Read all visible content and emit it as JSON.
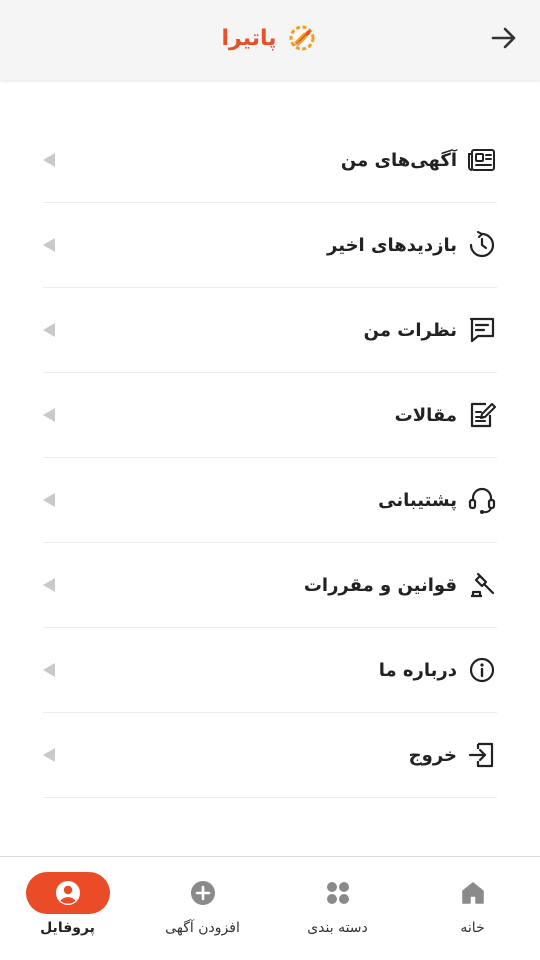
{
  "header": {
    "brand_name": "پاتیرا",
    "back_icon": "arrow-right-icon",
    "logo_icon": "gear-rocket-logo",
    "accent_color": "#e8502a"
  },
  "menu": {
    "items": [
      {
        "label": "آگهی‌های من",
        "icon": "ads-list-icon"
      },
      {
        "label": "بازدیدهای اخیر",
        "icon": "history-icon"
      },
      {
        "label": "نظرات من",
        "icon": "comment-icon"
      },
      {
        "label": "مقالات",
        "icon": "article-edit-icon"
      },
      {
        "label": "پشتیبانی",
        "icon": "headset-icon"
      },
      {
        "label": "قوانین و مقررات",
        "icon": "gavel-icon"
      },
      {
        "label": "درباره ما",
        "icon": "info-icon"
      },
      {
        "label": "خروج",
        "icon": "logout-icon"
      }
    ]
  },
  "bottom_nav": {
    "items": [
      {
        "label": "خانه",
        "icon": "home-icon",
        "active": false
      },
      {
        "label": "دسته بندی",
        "icon": "categories-icon",
        "active": false
      },
      {
        "label": "افزودن آگهی",
        "icon": "add-circle-icon",
        "active": false
      },
      {
        "label": "پروفایل",
        "icon": "profile-icon",
        "active": true
      }
    ],
    "active_color": "#ea4c28"
  }
}
